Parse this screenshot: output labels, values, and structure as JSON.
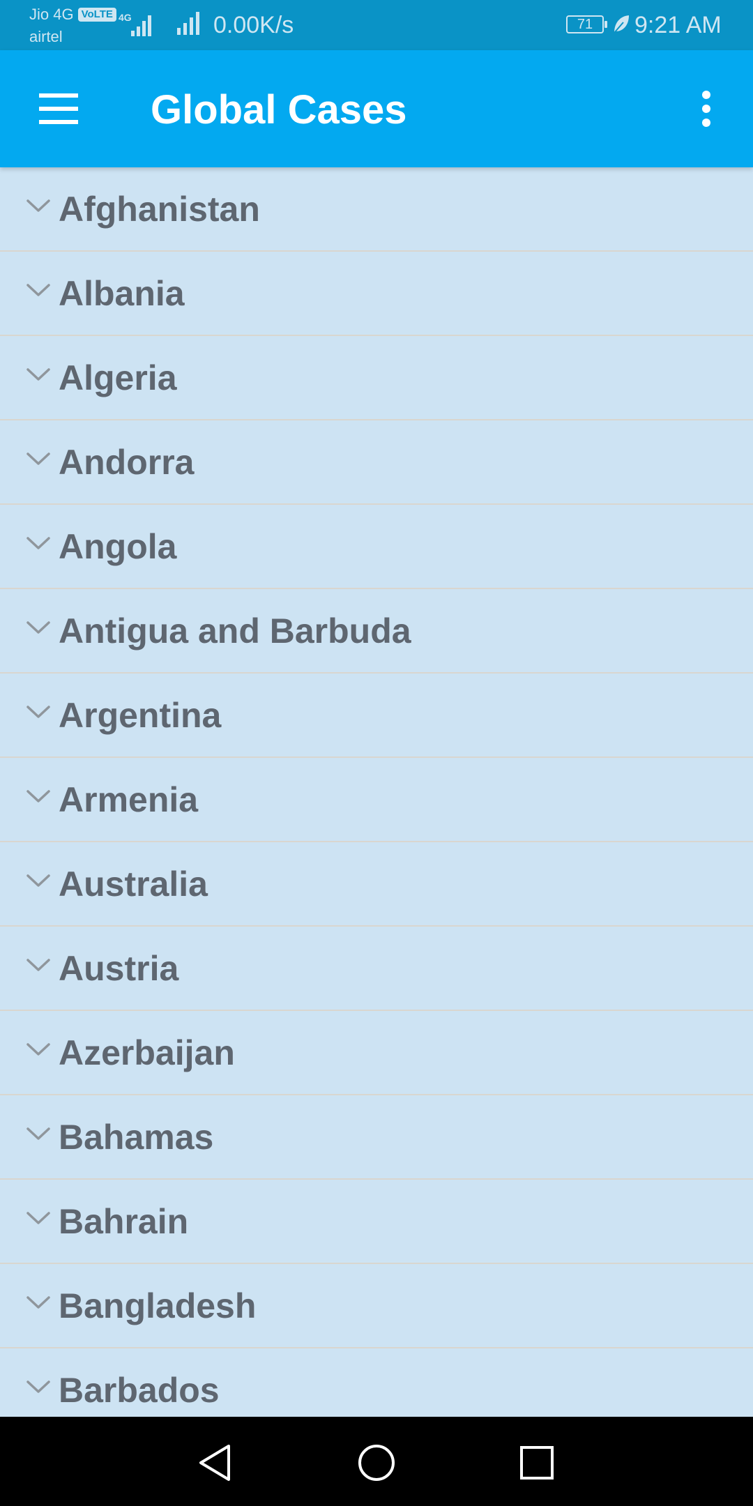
{
  "status_bar": {
    "carrier_primary": "Jio 4G",
    "volte_badge": "VoLTE",
    "carrier_secondary": "airtel",
    "network_speed": "0.00K/s",
    "battery_level": "71",
    "time": "9:21 AM"
  },
  "app_bar": {
    "title": "Global Cases",
    "menu_icon": "hamburger-menu-icon",
    "more_icon": "more-vertical-icon",
    "background_color": "#03a9f0"
  },
  "countries": [
    {
      "name": "Afghanistan"
    },
    {
      "name": "Albania"
    },
    {
      "name": "Algeria"
    },
    {
      "name": "Andorra"
    },
    {
      "name": "Angola"
    },
    {
      "name": "Antigua and Barbuda"
    },
    {
      "name": "Argentina"
    },
    {
      "name": "Armenia"
    },
    {
      "name": "Australia"
    },
    {
      "name": "Austria"
    },
    {
      "name": "Azerbaijan"
    },
    {
      "name": "Bahamas"
    },
    {
      "name": "Bahrain"
    },
    {
      "name": "Bangladesh"
    },
    {
      "name": "Barbados"
    }
  ],
  "list_style": {
    "background_color": "#cde3f3",
    "text_color": "#5e6670",
    "divider_color": "#d9d6cf",
    "item_icon": "chevron-down-icon"
  },
  "nav_bar": {
    "back_icon": "back-triangle-icon",
    "home_icon": "home-circle-icon",
    "recents_icon": "recents-square-icon"
  }
}
